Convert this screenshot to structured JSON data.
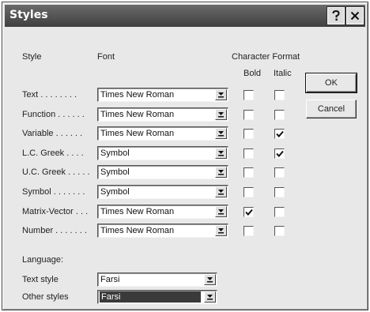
{
  "window": {
    "title": "Styles",
    "help_icon": "help-icon",
    "close_icon": "close-icon"
  },
  "headers": {
    "style": "Style",
    "font": "Font",
    "character_format": "Character Format",
    "bold": "Bold",
    "italic": "Italic"
  },
  "rows": [
    {
      "label": "Text . . . . . . . .",
      "font": "Times New Roman",
      "bold": false,
      "italic": false
    },
    {
      "label": "Function . . . . . .",
      "font": "Times New Roman",
      "bold": false,
      "italic": false
    },
    {
      "label": "Variable . . . . . .",
      "font": "Times New Roman",
      "bold": false,
      "italic": true
    },
    {
      "label": "L.C. Greek . . . .",
      "font": "Symbol",
      "bold": false,
      "italic": true
    },
    {
      "label": "U.C. Greek . . . . .",
      "font": "Symbol",
      "bold": false,
      "italic": false
    },
    {
      "label": "Symbol . . . . . . .",
      "font": "Symbol",
      "bold": false,
      "italic": false
    },
    {
      "label": "Matrix-Vector . . .",
      "font": "Times New Roman",
      "bold": true,
      "italic": false
    },
    {
      "label": "Number . . . . . . .",
      "font": "Times New Roman",
      "bold": false,
      "italic": false
    }
  ],
  "language": {
    "heading": "Language:",
    "text_style_label": "Text style",
    "text_style_value": "Farsi",
    "other_styles_label": "Other styles",
    "other_styles_value": "Farsi"
  },
  "buttons": {
    "ok": "OK",
    "cancel": "Cancel"
  }
}
